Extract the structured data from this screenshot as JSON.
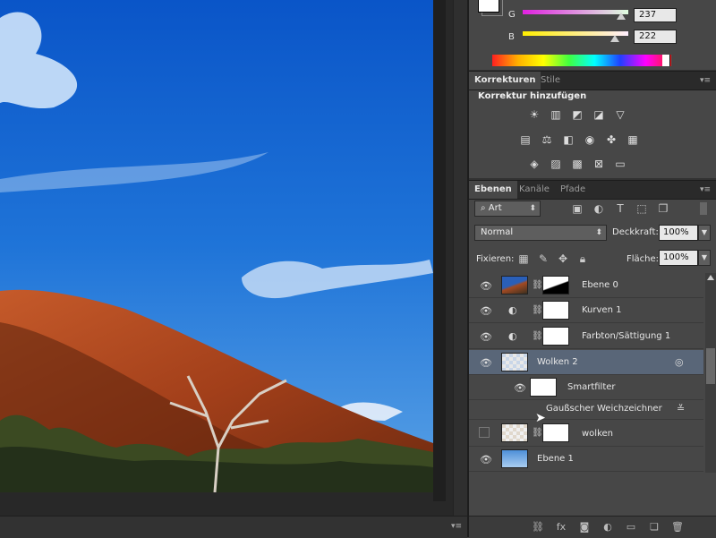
{
  "color_panel": {
    "sliders": [
      {
        "label": "G",
        "value": "237",
        "fraction": 0.93,
        "track": "linear-gradient(to right,#e020e0,#e0ffe0)"
      },
      {
        "label": "B",
        "value": "222",
        "fraction": 0.87,
        "track": "linear-gradient(to right,#ffee00,#ffeeff)"
      }
    ]
  },
  "korrekturen": {
    "tabs": [
      "Korrekturen",
      "Stile"
    ],
    "heading": "Korrektur hinzufügen",
    "icon_rows": [
      [
        "brightness-icon",
        "levels-icon",
        "curves-icon",
        "exposure-icon",
        "vibrance-icon"
      ],
      [
        "hue-saturation-icon",
        "color-balance-icon",
        "black-white-icon",
        "photo-filter-icon",
        "channel-mixer-icon",
        "color-lookup-icon"
      ],
      [
        "invert-icon",
        "posterize-icon",
        "threshold-icon",
        "selective-color-icon",
        "gradient-map-icon"
      ]
    ]
  },
  "layers": {
    "tabs": [
      "Ebenen",
      "Kanäle",
      "Pfade"
    ],
    "filter_kind": "Art",
    "blend_mode": "Normal",
    "opacity_label": "Deckkraft:",
    "opacity_value": "100%",
    "lock_label": "Fixieren:",
    "fill_label": "Fläche:",
    "fill_value": "100%",
    "rows": [
      {
        "name": "Ebene 0",
        "visible": true,
        "kind": "photo-with-mask"
      },
      {
        "name": "Kurven 1",
        "visible": true,
        "kind": "adjustment"
      },
      {
        "name": "Farbton/Sättigung 1",
        "visible": true,
        "kind": "adjustment"
      },
      {
        "name": "Wolken 2",
        "visible": true,
        "kind": "smart-object",
        "selected": true
      },
      {
        "name": "Smartfilter",
        "visible": true,
        "kind": "smart-filter"
      },
      {
        "name": "Gaußscher Weichzeichner",
        "visible": true,
        "kind": "filter-entry"
      },
      {
        "name": "wolken",
        "visible": false,
        "kind": "transparent-with-mask"
      },
      {
        "name": "Ebene 1",
        "visible": true,
        "kind": "gradient"
      }
    ],
    "footer_icons": [
      "link-icon",
      "fx-icon",
      "mask-icon",
      "adjustment-icon",
      "folder-icon",
      "new-layer-icon",
      "trash-icon"
    ]
  }
}
